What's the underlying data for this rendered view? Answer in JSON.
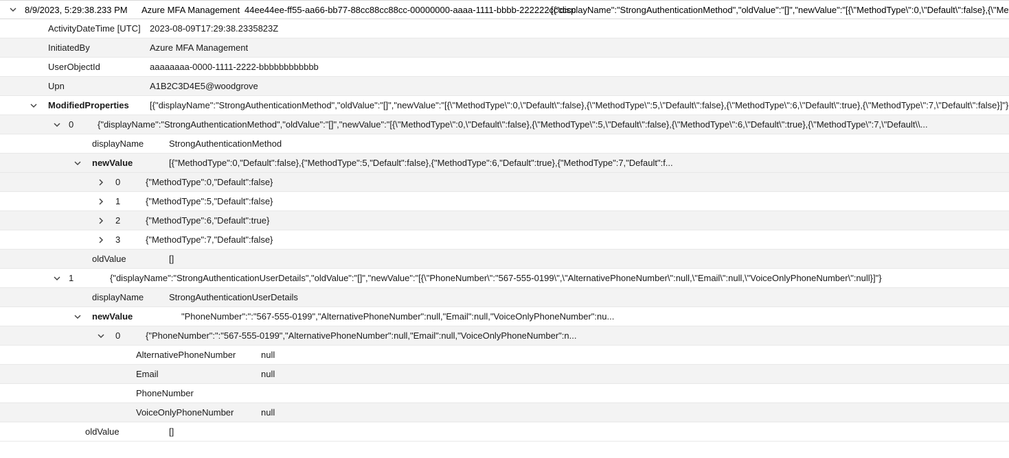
{
  "header": {
    "date": "8/9/2023, 5:29:38.233 PM",
    "service": "Azure MFA Management",
    "correlationId": "44ee44ee-ff55-aa66-bb77-88cc88cc88cc-00000000-aaaa-1111-bbbb-222222cccccc",
    "summary": "[{\"displayName\":\"StrongAuthenticationMethod\",\"oldValue\":\"[]\",\"newValue\":\"[{\\\"MethodType\\\":0,\\\"Default\\\":false},{\\\"Meth"
  },
  "details": {
    "activityDateTime_label": "ActivityDateTime [UTC]",
    "activityDateTime_value": "2023-08-09T17:29:38.2335823Z",
    "initiatedBy_label": "InitiatedBy",
    "initiatedBy_value": "Azure MFA Management",
    "userObjectId_label": "UserObjectId",
    "userObjectId_value": "aaaaaaaa-0000-1111-2222-bbbbbbbbbbbb",
    "upn_label": "Upn",
    "upn_value": "A1B2C3D4E5@woodgrove"
  },
  "modified": {
    "label": "ModifiedProperties",
    "summary": "[{\"displayName\":\"StrongAuthenticationMethod\",\"oldValue\":\"[]\",\"newValue\":\"[{\\\"MethodType\\\":0,\\\"Default\\\":false},{\\\"MethodType\\\":5,\\\"Default\\\":false},{\\\"MethodType\\\":6,\\\"Default\\\":true},{\\\"MethodType\\\":7,\\\"Default\\\":false}]\"},{\"c"
  },
  "mp0": {
    "index": "0",
    "summary": "{\"displayName\":\"StrongAuthenticationMethod\",\"oldValue\":\"[]\",\"newValue\":\"[{\\\"MethodType\\\":0,\\\"Default\\\":false},{\\\"MethodType\\\":5,\\\"Default\\\":false},{\\\"MethodType\\\":6,\\\"Default\\\":true},{\\\"MethodType\\\":7,\\\"Default\\\\...",
    "displayName_label": "displayName",
    "displayName_value": "StrongAuthenticationMethod",
    "newValue_label": "newValue",
    "newValue_summary": "[{\"MethodType\":0,\"Default\":false},{\"MethodType\":5,\"Default\":false},{\"MethodType\":6,\"Default\":true},{\"MethodType\":7,\"Default\":f...",
    "items": [
      {
        "idx": "0",
        "val": "{\"MethodType\":0,\"Default\":false}",
        "alt": true
      },
      {
        "idx": "1",
        "val": "{\"MethodType\":5,\"Default\":false}",
        "alt": false
      },
      {
        "idx": "2",
        "val": "{\"MethodType\":6,\"Default\":true}",
        "alt": true
      },
      {
        "idx": "3",
        "val": "{\"MethodType\":7,\"Default\":false}",
        "alt": false
      }
    ],
    "oldValue_label": "oldValue",
    "oldValue_value": "[]"
  },
  "mp1": {
    "index": "1",
    "summary": "{\"displayName\":\"StrongAuthenticationUserDetails\",\"oldValue\":\"[]\",\"newValue\":\"[{\\\"PhoneNumber\\\":\"567-555-0199\\\",\\\"AlternativePhoneNumber\\\":null,\\\"Email\\\":null,\\\"VoiceOnlyPhoneNumber\\\":null}]\"}",
    "displayName_label": "displayName",
    "displayName_value": "StrongAuthenticationUserDetails",
    "newValue_label": "newValue",
    "newValue_summary": "\"PhoneNumber\":\":\"567-555-0199\",\"AlternativePhoneNumber\":null,\"Email\":null,\"VoiceOnlyPhoneNumber\":nu...",
    "item0": {
      "idx": "0",
      "summary": "{\"PhoneNumber\":\":\"567-555-0199\",\"AlternativePhoneNumber\":null,\"Email\":null,\"VoiceOnlyPhoneNumber\":n...",
      "AlternativePhoneNumber_label": "AlternativePhoneNumber",
      "AlternativePhoneNumber_value": "null",
      "Email_label": "Email",
      "Email_value": "null",
      "PhoneNumber_label": "PhoneNumber",
      "PhoneNumber_value": "",
      "VoiceOnlyPhoneNumber_label": "VoiceOnlyPhoneNumber",
      "VoiceOnlyPhoneNumber_value": "null"
    },
    "oldValue_label": "oldValue",
    "oldValue_value": "[]"
  }
}
